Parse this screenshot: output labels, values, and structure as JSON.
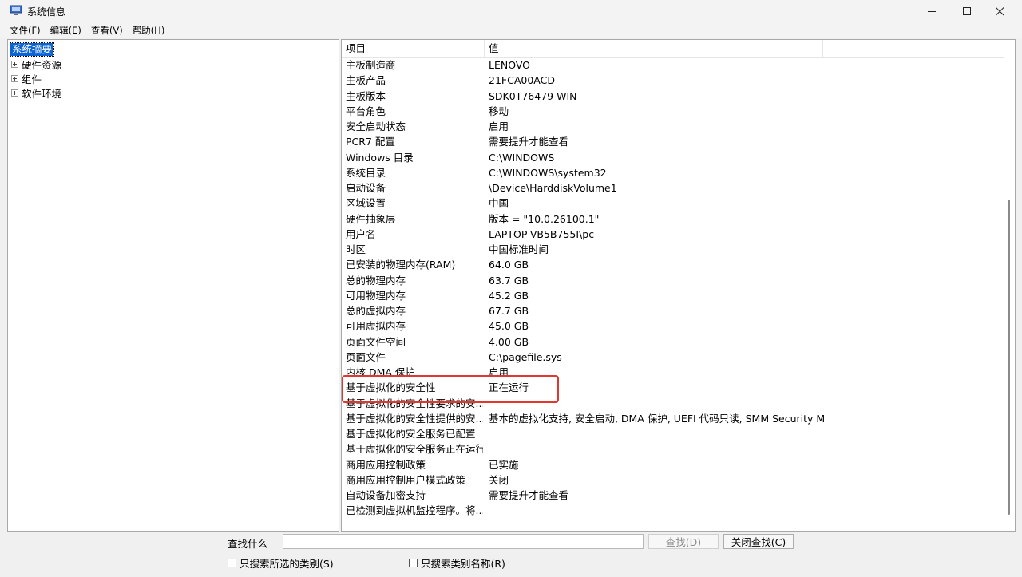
{
  "window": {
    "title": "系统信息"
  },
  "menu": [
    "文件(F)",
    "编辑(E)",
    "查看(V)",
    "帮助(H)"
  ],
  "tree": {
    "root": "系统摘要",
    "children": [
      "硬件资源",
      "组件",
      "软件环境"
    ]
  },
  "table": {
    "headers": {
      "item": "项目",
      "value": "值"
    },
    "rows": [
      {
        "item": "主板制造商",
        "value": "LENOVO"
      },
      {
        "item": "主板产品",
        "value": "21FCA00ACD"
      },
      {
        "item": "主板版本",
        "value": "SDK0T76479 WIN"
      },
      {
        "item": "平台角色",
        "value": "移动"
      },
      {
        "item": "安全启动状态",
        "value": "启用"
      },
      {
        "item": "PCR7 配置",
        "value": "需要提升才能查看"
      },
      {
        "item": "Windows 目录",
        "value": "C:\\WINDOWS"
      },
      {
        "item": "系统目录",
        "value": "C:\\WINDOWS\\system32"
      },
      {
        "item": "启动设备",
        "value": "\\Device\\HarddiskVolume1"
      },
      {
        "item": "区域设置",
        "value": "中国"
      },
      {
        "item": "硬件抽象层",
        "value": "版本 = \"10.0.26100.1\""
      },
      {
        "item": "用户名",
        "value": "LAPTOP-VB5B755I\\pc"
      },
      {
        "item": "时区",
        "value": "中国标准时间"
      },
      {
        "item": "已安装的物理内存(RAM)",
        "value": "64.0 GB"
      },
      {
        "item": "总的物理内存",
        "value": "63.7 GB"
      },
      {
        "item": "可用物理内存",
        "value": "45.2 GB"
      },
      {
        "item": "总的虚拟内存",
        "value": "67.7 GB"
      },
      {
        "item": "可用虚拟内存",
        "value": "45.0 GB"
      },
      {
        "item": "页面文件空间",
        "value": "4.00 GB"
      },
      {
        "item": "页面文件",
        "value": "C:\\pagefile.sys"
      },
      {
        "item": "内核 DMA 保护",
        "value": "启用"
      },
      {
        "item": "基于虚拟化的安全性",
        "value": "正在运行"
      },
      {
        "item": "基于虚拟化的安全性要求的安...",
        "value": ""
      },
      {
        "item": "基于虚拟化的安全性提供的安...",
        "value": "基本的虚拟化支持, 安全启动, DMA 保护, UEFI 代码只读, SMM Security M..."
      },
      {
        "item": "基于虚拟化的安全服务已配置",
        "value": ""
      },
      {
        "item": "基于虚拟化的安全服务正在运行",
        "value": ""
      },
      {
        "item": "商用应用控制政策",
        "value": "已实施"
      },
      {
        "item": "商用应用控制用户模式政策",
        "value": "关闭"
      },
      {
        "item": "自动设备加密支持",
        "value": "需要提升才能查看"
      },
      {
        "item": "已检测到虚拟机监控程序。将...",
        "value": ""
      }
    ]
  },
  "find": {
    "label": "查找什么",
    "input_value": "",
    "find_button": "查找(D)",
    "close_find_button": "关闭查找(C)",
    "only_selected_category": "只搜索所选的类别(S)",
    "only_category_names": "只搜索类别名称(R)"
  },
  "colors": {
    "selection": "#0a64d6",
    "highlight_box": "#e0372e"
  }
}
